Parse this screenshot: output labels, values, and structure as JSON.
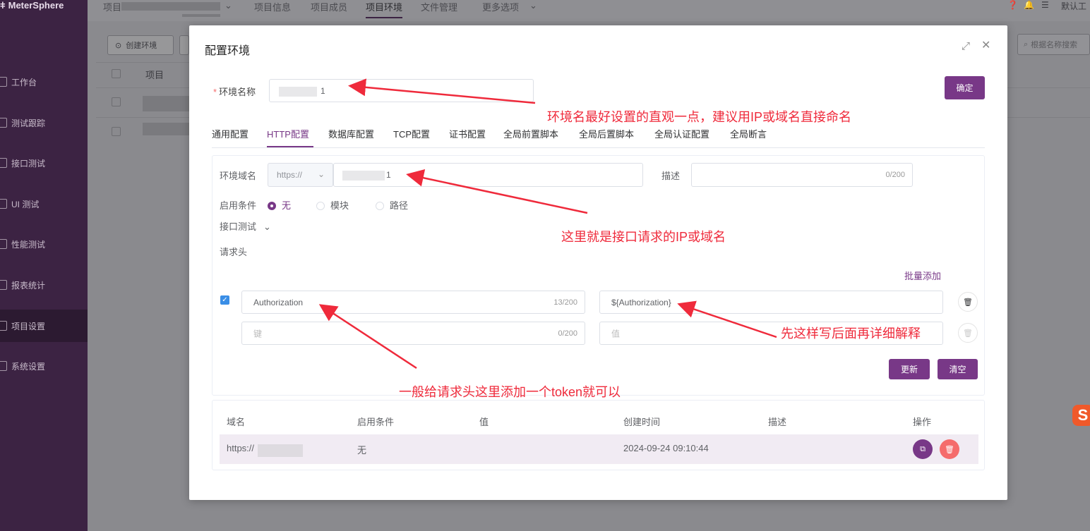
{
  "app": {
    "logo": "MeterSphere",
    "sidebar": [
      {
        "label": "工作台"
      },
      {
        "label": "测试跟踪"
      },
      {
        "label": "接口测试"
      },
      {
        "label": "UI 测试"
      },
      {
        "label": "性能测试"
      },
      {
        "label": "报表统计"
      },
      {
        "label": "项目设置",
        "active": true
      },
      {
        "label": "系统设置"
      }
    ],
    "topnav": {
      "project_prefix": "项目",
      "items": [
        "项目信息",
        "项目成员",
        "项目环境",
        "文件管理",
        "更多选项"
      ],
      "active": "项目环境",
      "right_label": "默认工"
    },
    "toolbar": {
      "create_label": "创建环境",
      "search_placeholder": "根据名称搜索"
    },
    "table_header": {
      "col_project": "项目"
    }
  },
  "dialog": {
    "title": "配置环境",
    "env_name_label": "环境名称",
    "env_name_value_suffix": "1",
    "confirm_label": "确定",
    "tabs": [
      "通用配置",
      "HTTP配置",
      "数据库配置",
      "TCP配置",
      "证书配置",
      "全局前置脚本",
      "全局后置脚本",
      "全局认证配置",
      "全局断言"
    ],
    "active_tab": "HTTP配置",
    "http": {
      "domain_label": "环境域名",
      "protocol": "https://",
      "domain_value_suffix": "1",
      "desc_label": "描述",
      "desc_count": "0/200",
      "condition_label": "启用条件",
      "conditions": [
        {
          "label": "无",
          "checked": true
        },
        {
          "label": "模块",
          "checked": false
        },
        {
          "label": "路径",
          "checked": false
        }
      ],
      "module_label": "接口测试",
      "headers_label": "请求头",
      "batch_add": "批量添加",
      "headers": [
        {
          "enabled": true,
          "key": "Authorization",
          "key_count": "13/200",
          "value": "${Authorization}"
        },
        {
          "enabled": false,
          "key_placeholder": "键",
          "key_count": "0/200",
          "value_placeholder": "值"
        }
      ],
      "update_label": "更新",
      "clear_label": "清空"
    },
    "list": {
      "columns": [
        "域名",
        "启用条件",
        "值",
        "创建时间",
        "描述",
        "操作"
      ],
      "rows": [
        {
          "domain": "https://",
          "condition": "无",
          "value": "",
          "created": "2024-09-24 09:10:44",
          "desc": ""
        }
      ]
    }
  },
  "annotations": [
    "环境名最好设置的直观一点，建议用IP或域名直接命名",
    "这里就是接口请求的IP或域名",
    "先这样写后面再详细解释",
    "一般给请求头这里添加一个token就可以"
  ],
  "colors": {
    "brand": "#783887",
    "annotation": "#ef2a3b",
    "danger": "#f56c6c"
  }
}
